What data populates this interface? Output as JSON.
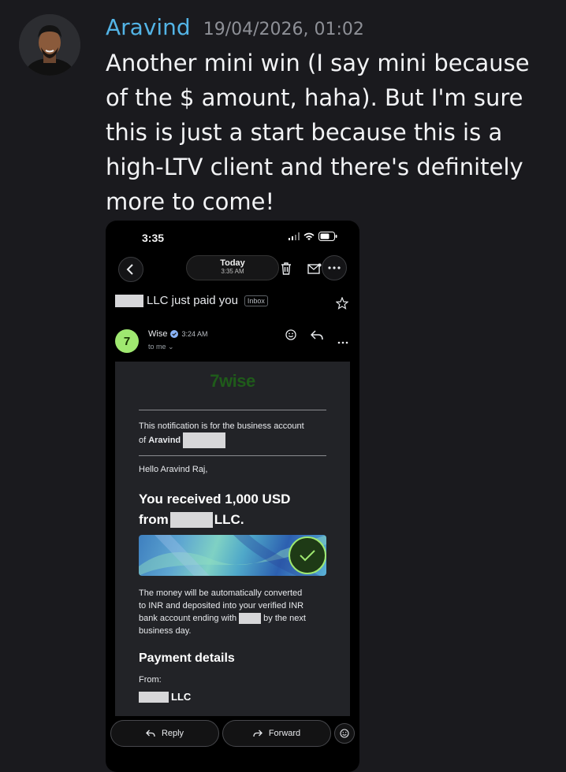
{
  "message": {
    "author": "Aravind",
    "timestamp": "19/04/2026, 01:02",
    "text": "Another mini win (I say mini because of the $ amount, haha). But I'm sure this is just a start because this is a high-LTV client and there's definitely more to come!"
  },
  "phone": {
    "status_time": "3:35",
    "top_bar": {
      "today_label": "Today",
      "today_time": "3:35 AM"
    },
    "subject": {
      "text": "LLC just paid you",
      "badge": "Inbox"
    },
    "sender": {
      "avatar_glyph": "7",
      "name": "Wise",
      "time": "3:24 AM",
      "recipient": "to me"
    },
    "email": {
      "logo": "7wise",
      "notice_line1": "This notification is for the business account",
      "notice_line2_prefix": "of",
      "notice_name": "Aravind",
      "greeting": "Hello Aravind Raj,",
      "headline_line1": "You received 1,000 USD",
      "headline_line2_prefix": "from",
      "headline_line2_suffix": "LLC.",
      "body_line1": "The money will be automatically converted",
      "body_line2": "to INR and deposited into your verified INR",
      "body_line3_prefix": "bank account ending with",
      "body_line3_suffix": "by the next",
      "body_line4": "business day.",
      "payment_details_title": "Payment details",
      "from_label": "From:",
      "from_value": "LLC"
    },
    "actions": {
      "reply_label": "Reply",
      "forward_label": "Forward"
    }
  },
  "colors": {
    "author": "#53b4e6",
    "wise_green": "#9fe870",
    "background": "#1a1a1e"
  }
}
